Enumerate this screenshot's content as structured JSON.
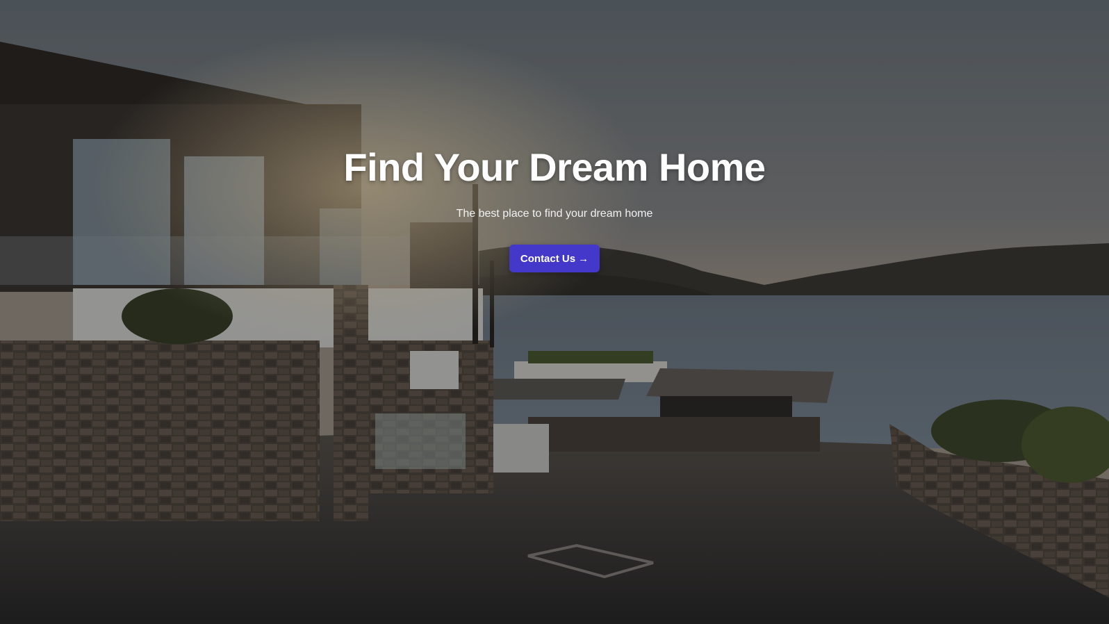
{
  "hero": {
    "title": "Find Your Dream Home",
    "subtitle": "The best place to find your dream home",
    "cta_label": "Contact Us",
    "cta_icon": "arrow-right-icon",
    "cta_arrow": "→"
  },
  "colors": {
    "accent": "#4338ca",
    "title": "#ffffff",
    "subtitle": "#f2f2f2",
    "overlay": "rgba(0,0,0,0.32)"
  }
}
